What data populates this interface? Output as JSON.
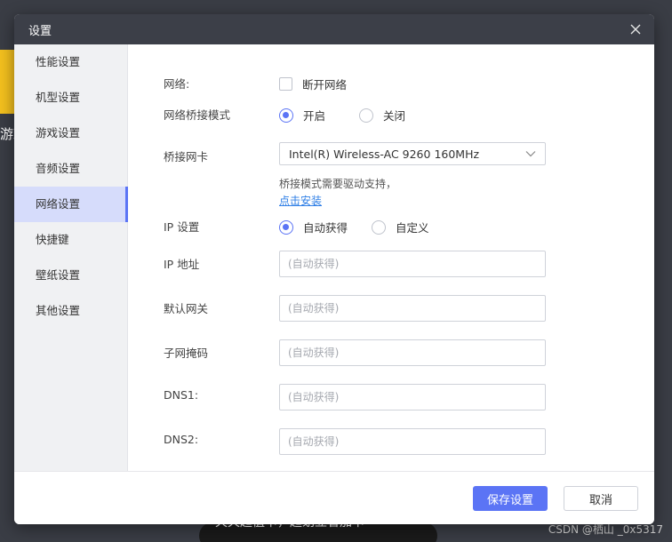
{
  "background": {
    "side_text": "游戏",
    "pill_text": "天天超值卡，超划立省加卡",
    "watermark": "CSDN @栖山 _0x5317"
  },
  "dialog": {
    "title": "设置",
    "close_icon": "close-icon"
  },
  "sidebar": {
    "items": [
      {
        "label": "性能设置"
      },
      {
        "label": "机型设置"
      },
      {
        "label": "游戏设置"
      },
      {
        "label": "音频设置"
      },
      {
        "label": "网络设置",
        "active": true
      },
      {
        "label": "快捷键"
      },
      {
        "label": "壁纸设置"
      },
      {
        "label": "其他设置"
      }
    ]
  },
  "network": {
    "network_label": "网络:",
    "disconnect_label": "断开网络",
    "disconnect_checked": false,
    "bridge_mode_label": "网络桥接模式",
    "bridge_on_label": "开启",
    "bridge_off_label": "关闭",
    "bridge_selected": "开启",
    "adapter_label": "桥接网卡",
    "adapter_value": "Intel(R) Wireless-AC 9260 160MHz",
    "driver_hint": "桥接模式需要驱动支持，",
    "install_link": "点击安装",
    "ip_setting_label": "IP 设置",
    "ip_auto_label": "自动获得",
    "ip_custom_label": "自定义",
    "ip_selected": "自动获得",
    "ip_address_label": "IP 地址",
    "gateway_label": "默认网关",
    "subnet_label": "子网掩码",
    "dns1_label": "DNS1:",
    "dns2_label": "DNS2:",
    "auto_placeholder": "(自动获得)"
  },
  "footer": {
    "save_label": "保存设置",
    "cancel_label": "取消"
  },
  "colors": {
    "accent": "#5b74f5",
    "titlebar": "#3c3f48",
    "link": "#2f7fe6"
  }
}
